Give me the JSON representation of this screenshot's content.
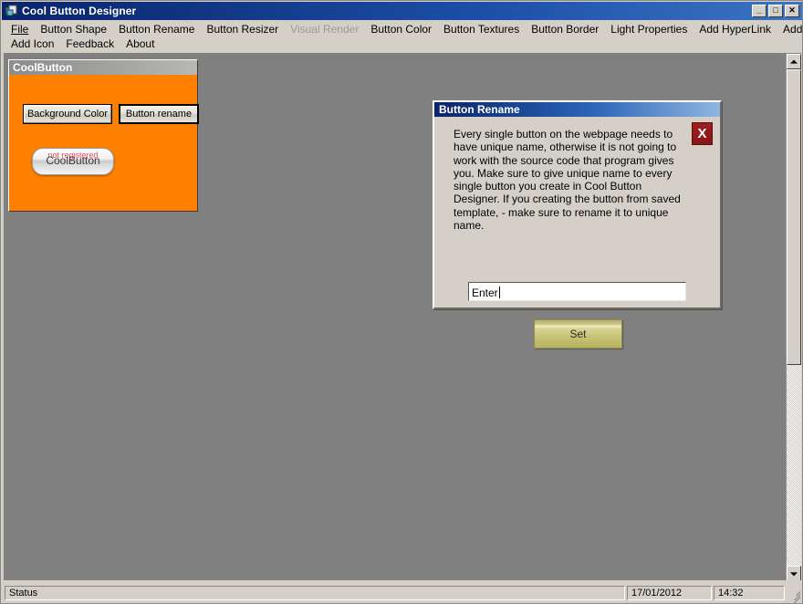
{
  "window": {
    "title": "Cool Button Designer",
    "icon": "app-icon",
    "controls": [
      {
        "name": "minimize",
        "glyph": "_"
      },
      {
        "name": "maximize",
        "glyph": "□"
      },
      {
        "name": "close",
        "glyph": "✕"
      }
    ]
  },
  "menu": {
    "row1": [
      {
        "label": "File",
        "disabled": false
      },
      {
        "label": "Button Shape",
        "disabled": false
      },
      {
        "label": "Button Rename",
        "disabled": false
      },
      {
        "label": "Button Resizer",
        "disabled": false
      },
      {
        "label": "Visual Render",
        "disabled": true
      },
      {
        "label": "Button Color",
        "disabled": false
      },
      {
        "label": "Button Textures",
        "disabled": false
      },
      {
        "label": "Button Border",
        "disabled": false
      },
      {
        "label": "Light Properties",
        "disabled": false
      },
      {
        "label": "Add HyperLink",
        "disabled": false
      },
      {
        "label": "Add Text",
        "disabled": false
      }
    ],
    "row2": [
      {
        "label": "Add Icon",
        "disabled": false
      },
      {
        "label": "Feedback",
        "disabled": false
      },
      {
        "label": "About",
        "disabled": false
      }
    ]
  },
  "panel": {
    "caption": "CoolButton",
    "background_color": "#ff8000",
    "background_color_button": "Background Color",
    "rename_button": "Button rename",
    "preview": {
      "label": "CoolButton",
      "watermark": "not registered",
      "watermark_color": "#ef4455"
    }
  },
  "dialog": {
    "title": "Button Rename",
    "close_label": "X",
    "close_color": "#9e1f22",
    "message": "Every single button on the webpage needs to have unique name, otherwise it is not going to work with the source code that program gives you. Make sure to give unique name to every single button you create in Cool Button Designer. If you creating the button from saved template, - make sure to rename it to unique name.",
    "input_value": "Enter",
    "input_placeholder": "",
    "set_button": "Set"
  },
  "scrollbar": {
    "up_arrow": "scroll-up",
    "down_arrow": "scroll-down"
  },
  "statusbar": {
    "status": "Status",
    "date": "17/01/2012",
    "time": "14:32"
  }
}
